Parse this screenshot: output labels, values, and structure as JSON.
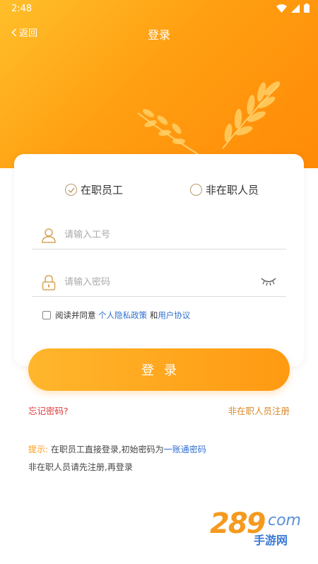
{
  "status_bar": {
    "time": "2:48"
  },
  "nav": {
    "back_label": "返回",
    "title": "登录"
  },
  "role": {
    "staff_label": "在职员工",
    "non_staff_label": "非在职人员",
    "selected": "在职员工"
  },
  "form": {
    "username_placeholder": "请输入工号",
    "password_placeholder": "请输入密码",
    "agree_prefix": "阅读并同意",
    "privacy_link": "个人隐私政策",
    "and_text": "和",
    "terms_link": "用户协议",
    "agree_checked": false
  },
  "login_button": "登录",
  "links": {
    "forgot": "忘记密码?",
    "register": "非在职人员注册"
  },
  "tips": {
    "label": "提示:",
    "line1_text": " 在职员工直接登录,初始密码为",
    "line1_highlight": "一账通密码",
    "line2": "非在职人员请先注册,再登录"
  },
  "watermark": {
    "number": "289",
    "domain": "com",
    "subtitle": "手游网"
  },
  "colors": {
    "accent": "#ff9a12",
    "link": "#2f6fcf",
    "forgot": "#e03a3a"
  }
}
